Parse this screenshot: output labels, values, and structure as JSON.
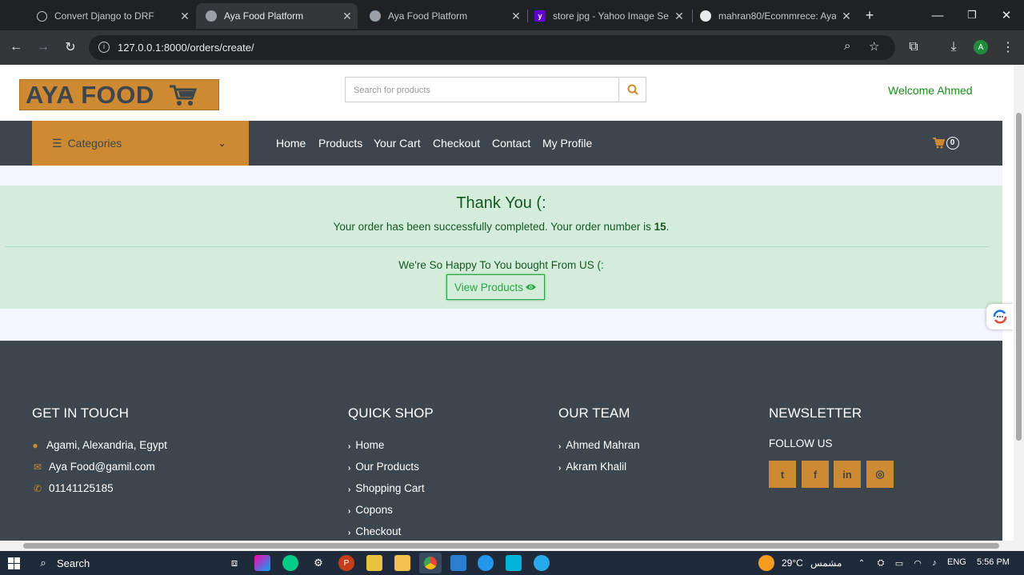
{
  "browser": {
    "tabs": [
      {
        "title": "Convert Django to DRF",
        "active": false
      },
      {
        "title": "Aya Food Platform",
        "active": true
      },
      {
        "title": "Aya Food Platform",
        "active": false
      },
      {
        "title": "store jpg - Yahoo Image Sea",
        "active": false
      },
      {
        "title": "mahran80/Ecommrece: Aya",
        "active": false
      }
    ],
    "new_tab": "+",
    "url": "127.0.0.1:8000/orders/create/",
    "profile_initial": "A"
  },
  "site": {
    "logo_text": "AYA FOOD",
    "search_placeholder": "Search for products",
    "welcome": "Welcome Ahmed",
    "categories_label": "Categories",
    "nav": [
      "Home",
      "Products",
      "Your Cart",
      "Checkout",
      "Contact",
      "My Profile"
    ],
    "cart_count": "0"
  },
  "order": {
    "heading": "Thank You (:",
    "message_prefix": "Your order has been successfully completed. Your order number is",
    "order_number": "15",
    "message_suffix": ".",
    "happy": "We're So Happy To You bought From US (:",
    "view_button": "View Products"
  },
  "footer": {
    "touch_heading": "GET IN TOUCH",
    "address": "Agami, Alexandria, Egypt",
    "email": "Aya Food@gamil.com",
    "phone": "01141125185",
    "shop_heading": "QUICK SHOP",
    "shop_links": [
      "Home",
      "Our Products",
      "Shopping Cart",
      "Copons",
      "Checkout"
    ],
    "team_heading": "OUR TEAM",
    "team": [
      "Ahmed Mahran",
      "Akram Khalil"
    ],
    "news_heading": "NEWSLETTER",
    "follow": "FOLLOW US",
    "social": [
      "twitter-icon",
      "facebook-icon",
      "linkedin-icon",
      "instagram-icon"
    ]
  },
  "taskbar": {
    "search": "Search",
    "weather_temp": "29°C",
    "weather_desc": "مشمس",
    "lang": "ENG",
    "time": "5:56 PM"
  },
  "colors": {
    "accent": "#cd8a32",
    "dark": "#3d464d",
    "success_bg": "#d4edda",
    "success_text": "#155724"
  }
}
